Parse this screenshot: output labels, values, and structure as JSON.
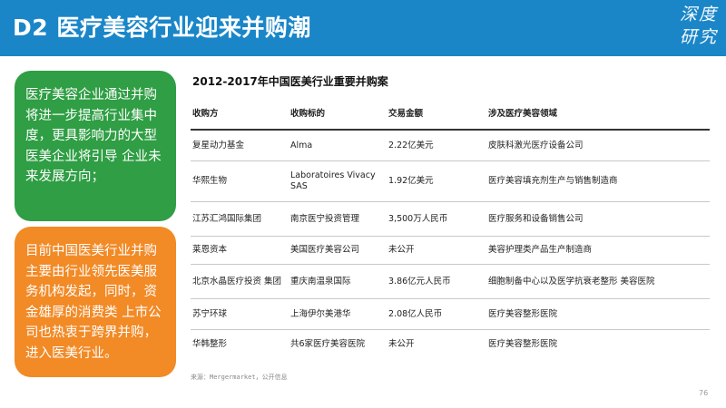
{
  "header": {
    "title": "D2  医疗美容行业迎来并购潮",
    "logo_lines": [
      "深度",
      "研究"
    ]
  },
  "cards": {
    "green_text": "医疗美容企业通过并购将进一步提高行业集中度，更具影响力的大型医美企业将引导 企业未来发展方向；",
    "orange_text": "目前中国医美行业并购主要由行业领先医美服务机构发起，同时，资金雄厚的消费类 上市公司也热衷于跨界并购，进入医美行业。"
  },
  "table": {
    "title": "2012-2017年中国医美行业重要并购案",
    "headers": [
      "收购方",
      "收购标的",
      "交易金额",
      "涉及医疗美容领域"
    ],
    "rows": [
      [
        "复星动力基金",
        "Alma",
        "2.22亿美元",
        "皮肤科激光医疗设备公司"
      ],
      [
        "华熙生物",
        "Laboratoires Vivacy SAS",
        "1.92亿美元",
        "医疗美容填充剂生产与销售制造商"
      ],
      [
        "江苏汇鸿国际集团",
        "南京医宁投资管理",
        "3,500万人民币",
        "医疗服务和设备销售公司"
      ],
      [
        "莱恩资本",
        "美国医疗美容公司",
        "未公开",
        "美容护理类产品生产制造商"
      ],
      [
        "北京水晶医疗投资 集团",
        "重庆南温泉国际",
        "3.86亿元人民币",
        "细胞制备中心以及医学抗衰老整形 美容医院"
      ],
      [
        "苏宁环球",
        "上海伊尔美港华",
        "2.08亿人民币",
        "医疗美容整形医院"
      ],
      [
        "华韩整形",
        "共6家医疗美容医院",
        "未公开",
        "医疗美容整形医院"
      ]
    ]
  },
  "source": "来源：Mergermarket，公开信息",
  "page_number": "76"
}
